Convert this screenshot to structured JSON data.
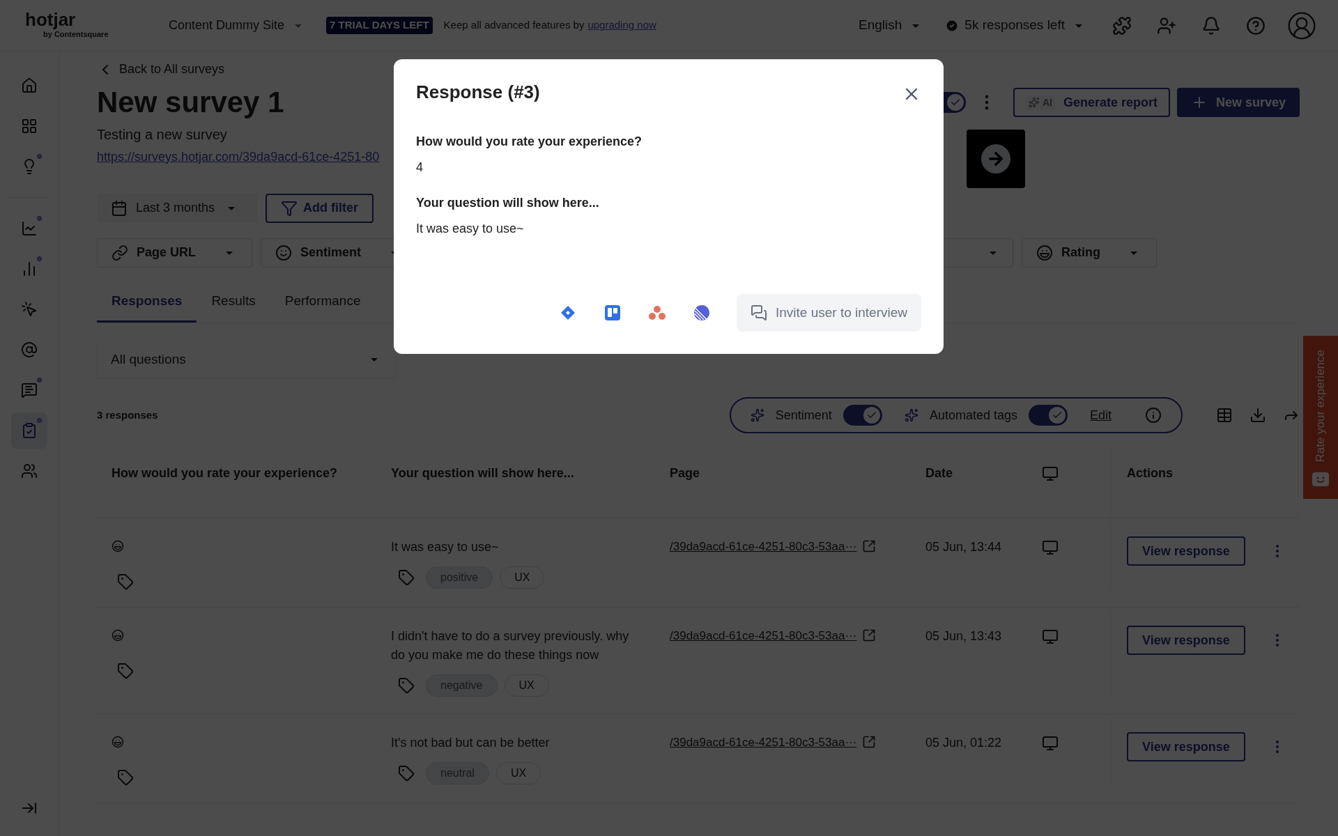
{
  "topbar": {
    "brand": "hotjar",
    "brand_sub": "by Contentsquare",
    "site": "Content Dummy Site",
    "trial_badge": "7 TRIAL DAYS LEFT",
    "trial_text": "Keep all advanced features by",
    "trial_link": "upgrading now",
    "language": "English",
    "responses_left": "5k responses left"
  },
  "sidebar": {
    "items": [
      {
        "kind": "home",
        "selected": false,
        "badge": false
      },
      {
        "kind": "dashboards",
        "selected": false,
        "badge": false
      },
      {
        "kind": "insights",
        "selected": false,
        "badge": true
      },
      {
        "kind": "divider",
        "selected": false,
        "badge": false
      },
      {
        "kind": "trends",
        "selected": false,
        "badge": true
      },
      {
        "kind": "funnels",
        "selected": false,
        "badge": true
      },
      {
        "kind": "recordings",
        "selected": false,
        "badge": false
      },
      {
        "kind": "interviews",
        "selected": false,
        "badge": false
      },
      {
        "kind": "feedback",
        "selected": false,
        "badge": true
      },
      {
        "kind": "surveys",
        "selected": true,
        "badge": true
      },
      {
        "kind": "users",
        "selected": false,
        "badge": false
      }
    ]
  },
  "header": {
    "back": "Back to All surveys",
    "title": "New survey 1",
    "description": "Testing a new survey",
    "url": "https://surveys.hotjar.com/39da9acd-61ce-4251-80",
    "survey_toggle": {
      "on": true
    },
    "ai_badge": "AI",
    "generate": "Generate report",
    "new_survey": "New survey"
  },
  "filters": {
    "date": "Last 3 months",
    "add_filter": "Add filter",
    "dropdowns": [
      {
        "kind": "link",
        "label": "Page URL"
      },
      {
        "kind": "smile",
        "label": "Sentiment"
      },
      {
        "kind": "hidden"
      },
      {
        "kind": "rating",
        "label": "Rating"
      }
    ]
  },
  "tabs": [
    {
      "label": "Responses",
      "selected": true
    },
    {
      "label": "Results",
      "selected": false
    },
    {
      "label": "Performance",
      "selected": false
    }
  ],
  "question_select": "All questions",
  "count": "3 responses",
  "ai_toggles": [
    {
      "label": "Sentiment",
      "on": true
    },
    {
      "label": "Automated tags",
      "on": true
    }
  ],
  "edit": "Edit",
  "table": {
    "columns": [
      "How would you rate your experience?",
      "Your question will show here...",
      "Page",
      "Date",
      "Actions"
    ],
    "rows": [
      {
        "answer": "It was easy to use~",
        "tags": [
          {
            "kind": "sentiment",
            "label": "positive"
          },
          {
            "kind": "topic",
            "label": "UX"
          }
        ],
        "page": "/39da9acd-61ce-4251-80c3-53aa···",
        "date": "05 Jun, 13:44",
        "action": "View response"
      },
      {
        "answer": "I didn't have to do a survey previously. why do you make me do these things now",
        "tags": [
          {
            "kind": "sentiment",
            "label": "negative"
          },
          {
            "kind": "topic",
            "label": "UX"
          }
        ],
        "page": "/39da9acd-61ce-4251-80c3-53aa···",
        "date": "05 Jun, 13:43",
        "action": "View response"
      },
      {
        "answer": "It's not bad but can be better",
        "tags": [
          {
            "kind": "sentiment",
            "label": "neutral"
          },
          {
            "kind": "topic",
            "label": "UX"
          }
        ],
        "page": "/39da9acd-61ce-4251-80c3-53aa···",
        "date": "05 Jun, 01:22",
        "action": "View response"
      }
    ]
  },
  "feedback_tab": {
    "label": "Rate your experience"
  },
  "modal": {
    "title": "Response (#3)",
    "answers": [
      {
        "question": "How would you rate your experience?",
        "answer": "4"
      },
      {
        "question": "Your question will show here...",
        "answer": "It was easy to use~"
      }
    ],
    "invite": "Invite user to interview"
  }
}
